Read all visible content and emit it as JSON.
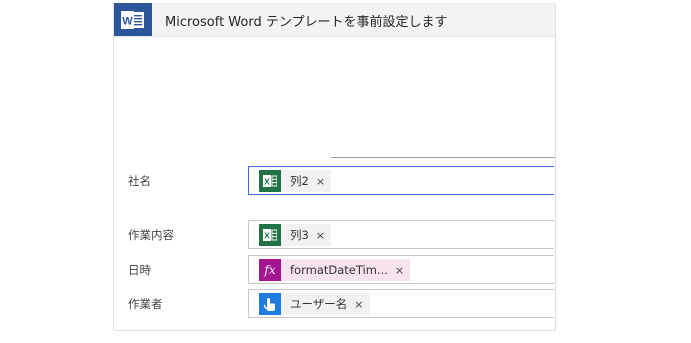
{
  "header": {
    "title": "Microsoft Word テンプレートを事前設定します",
    "app_icon": "word-icon",
    "app_color": "#2b579a"
  },
  "fields": [
    {
      "label": "社名",
      "token": {
        "type": "excel",
        "text": "列2",
        "remove": "×"
      }
    },
    {
      "label": "作業内容",
      "token": {
        "type": "excel",
        "text": "列3",
        "remove": "×"
      }
    },
    {
      "label": "日時",
      "token": {
        "type": "expression",
        "text": "formatDateTim...",
        "remove": "×",
        "icon_text": "fx"
      }
    },
    {
      "label": "作業者",
      "token": {
        "type": "user",
        "text": "ユーザー名",
        "remove": "×"
      }
    }
  ],
  "colors": {
    "excel": "#217346",
    "expression": "#a4168f",
    "user": "#1f7be0",
    "focus": "#3d6ed4"
  }
}
